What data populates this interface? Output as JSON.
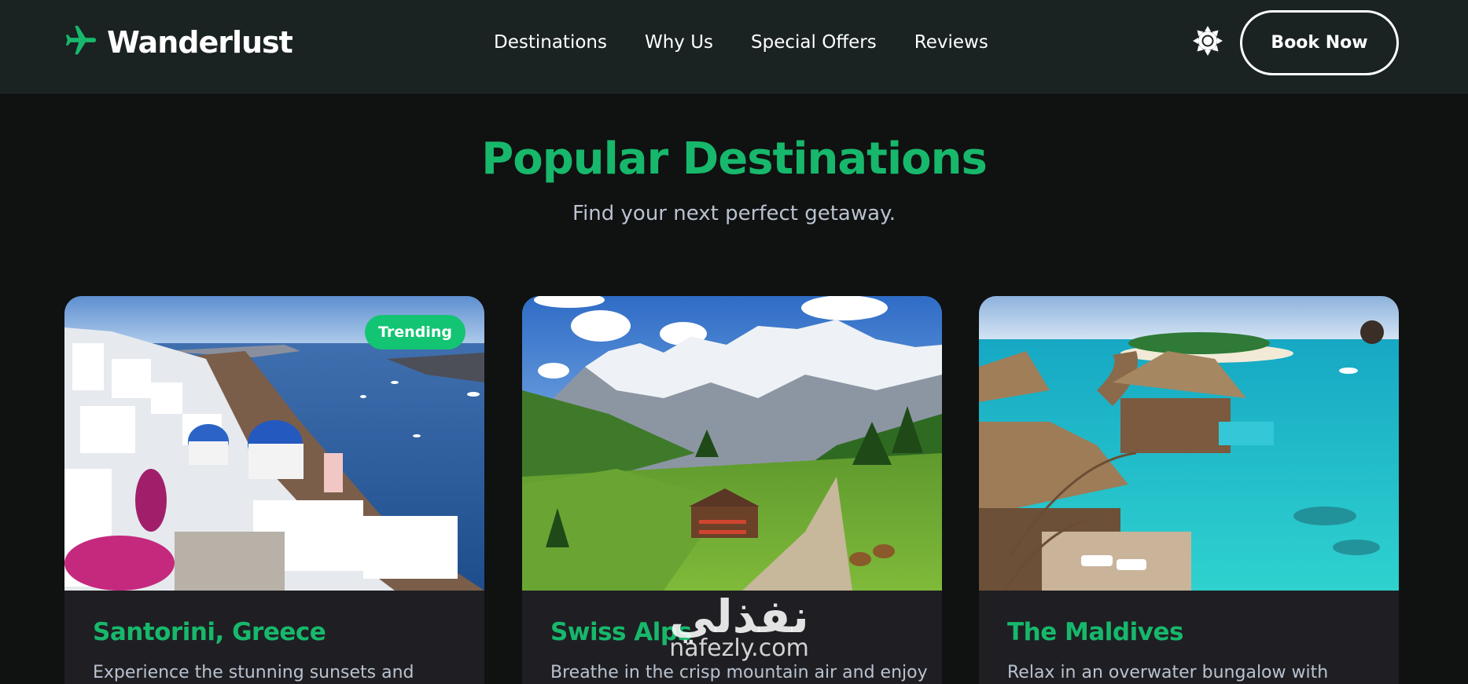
{
  "header": {
    "brand_name": "Wanderlust",
    "brand_icon": "airplane-icon",
    "nav": [
      "Destinations",
      "Why Us",
      "Special Offers",
      "Reviews"
    ],
    "theme_icon": "sun-icon",
    "cta_label": "Book Now"
  },
  "section": {
    "title": "Popular Destinations",
    "subtitle": "Find your next perfect getaway."
  },
  "cards": [
    {
      "title": "Santorini, Greece",
      "description": "Experience the stunning sunsets and",
      "badge": "Trending"
    },
    {
      "title": "Swiss Alps",
      "description": "Breathe in the crisp mountain air and enjoy"
    },
    {
      "title": "The Maldives",
      "description": "Relax in an overwater bungalow with"
    }
  ],
  "watermark": {
    "main": "نفذلي",
    "sub": "nafezly.com"
  },
  "colors": {
    "accent": "#17b86b",
    "badge": "#13c472",
    "header_bg": "#1a2222",
    "page_bg": "#101111",
    "card_bg": "#1f1f23"
  }
}
